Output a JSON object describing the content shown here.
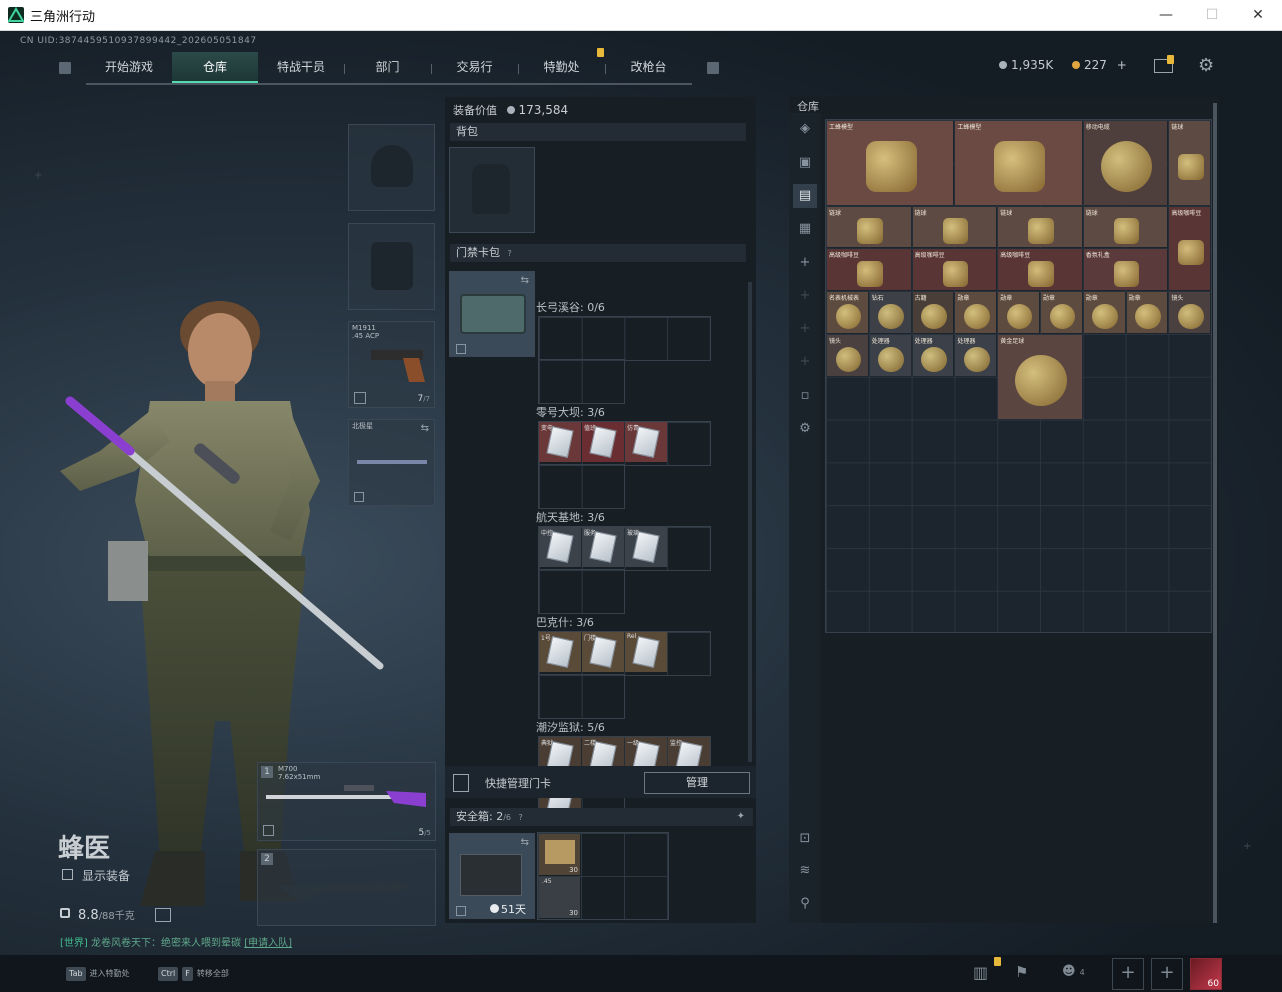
{
  "window": {
    "title": "三角洲行动",
    "min": "—",
    "max": "☐",
    "close": "✕"
  },
  "header": {
    "uid": "CN UID:3874459510937899442_202605051847",
    "tabs": [
      "开始游戏",
      "仓库",
      "特战干员",
      "部门",
      "交易行",
      "特勤处",
      "改枪台"
    ],
    "active_tab": 1,
    "currency1": "1,935K",
    "currency2": "227",
    "currency2_plus": "+",
    "colors": {
      "accent": "#56d9b1",
      "notify": "#e8b83a"
    }
  },
  "operator": {
    "name": "蜂医",
    "show_equipment": "显示装备",
    "weight_value": "8.8",
    "weight_max": "/88千克",
    "chat_channel": "[世界]",
    "chat_text": "龙卷风卷天下：绝密来人喂到晕碳",
    "chat_action": "[申请入队]"
  },
  "loadout": {
    "pistol_name": "M1911",
    "pistol_ammo": ".45 ACP",
    "pistol_count": "7",
    "pistol_max": "/7",
    "melee_name": "北极星",
    "primary_index": "1",
    "primary_name": "M700",
    "primary_ammo": "7.62x51mm",
    "primary_count": "5",
    "primary_max": "/5",
    "secondary_index": "2"
  },
  "gear": {
    "value_label": "装备价值",
    "value": "173,584",
    "backpack_label": "背包",
    "card_bag_label": "门禁卡包",
    "card_sections": [
      {
        "label": "长弓溪谷: 0/6",
        "cards": []
      },
      {
        "label": "零号大坝: 3/6",
        "cards": [
          "变电",
          "值班",
          "仿青"
        ]
      },
      {
        "label": "航天基地: 3/6",
        "cards": [
          "中控",
          "服务",
          "玻璃"
        ]
      },
      {
        "label": "巴克什: 3/6",
        "cards": [
          "1号",
          "门楼",
          "Rel"
        ]
      },
      {
        "label": "潮汐监狱: 5/6",
        "cards": [
          "典狱",
          "二楼",
          "一级",
          "监控",
          "三层"
        ]
      }
    ],
    "quick_manage_label": "快捷管理门卡",
    "manage_button": "管理",
    "safebox_label": "安全箱:",
    "safebox_count": "2",
    "safebox_max": "/6",
    "safebox_timer": "51天",
    "safebox_item1_count": "30",
    "safebox_item2_count": "30",
    "safebox_item2_tag": ".45"
  },
  "stash": {
    "title": "仓库",
    "items": [
      {
        "name": "工蜂模型",
        "col": 0,
        "row": 0,
        "w": 3,
        "h": 2,
        "bg": "#6b4a44"
      },
      {
        "name": "工蜂模型",
        "col": 3,
        "row": 0,
        "w": 3,
        "h": 2,
        "bg": "#6b4a44"
      },
      {
        "name": "移动电缆",
        "col": 6,
        "row": 0,
        "w": 2,
        "h": 2,
        "bg": "#4f3f3c"
      },
      {
        "name": "链球",
        "col": 8,
        "row": 0,
        "w": 1,
        "h": 2,
        "bg": "#5d4a43"
      },
      {
        "name": "链球",
        "col": 0,
        "row": 2,
        "w": 2,
        "h": 1,
        "bg": "#5d4a43"
      },
      {
        "name": "链球",
        "col": 2,
        "row": 2,
        "w": 2,
        "h": 1,
        "bg": "#5d4a43"
      },
      {
        "name": "链球",
        "col": 4,
        "row": 2,
        "w": 2,
        "h": 1,
        "bg": "#5d4a43"
      },
      {
        "name": "链球",
        "col": 6,
        "row": 2,
        "w": 2,
        "h": 1,
        "bg": "#5d4a43"
      },
      {
        "name": "高级咖啡豆",
        "col": 8,
        "row": 2,
        "w": 1,
        "h": 2,
        "bg": "#5a3536"
      },
      {
        "name": "高级咖啡豆",
        "col": 0,
        "row": 3,
        "w": 2,
        "h": 1,
        "bg": "#5a3536"
      },
      {
        "name": "高级咖啡豆",
        "col": 2,
        "row": 3,
        "w": 2,
        "h": 1,
        "bg": "#5a3536"
      },
      {
        "name": "高级咖啡豆",
        "col": 4,
        "row": 3,
        "w": 2,
        "h": 1,
        "bg": "#5a3536"
      },
      {
        "name": "香氛礼盒",
        "col": 6,
        "row": 3,
        "w": 2,
        "h": 1,
        "bg": "#5a3a3a"
      },
      {
        "name": "名表机械表",
        "col": 0,
        "row": 4,
        "w": 1,
        "h": 1,
        "bg": "#5d4b40"
      },
      {
        "name": "钻石",
        "col": 1,
        "row": 4,
        "w": 1,
        "h": 1,
        "bg": "#3e4048"
      },
      {
        "name": "古籍",
        "col": 2,
        "row": 4,
        "w": 1,
        "h": 1,
        "bg": "#4a3e38"
      },
      {
        "name": "勋章",
        "col": 3,
        "row": 4,
        "w": 1,
        "h": 1,
        "bg": "#5d4b40"
      },
      {
        "name": "勋章",
        "col": 4,
        "row": 4,
        "w": 1,
        "h": 1,
        "bg": "#5d4b40"
      },
      {
        "name": "勋章",
        "col": 5,
        "row": 4,
        "w": 1,
        "h": 1,
        "bg": "#5d4b40"
      },
      {
        "name": "勋章",
        "col": 6,
        "row": 4,
        "w": 1,
        "h": 1,
        "bg": "#5d4b40"
      },
      {
        "name": "勋章",
        "col": 7,
        "row": 4,
        "w": 1,
        "h": 1,
        "bg": "#5d4b40"
      },
      {
        "name": "镜头",
        "col": 8,
        "row": 4,
        "w": 1,
        "h": 1,
        "bg": "#4a4040"
      },
      {
        "name": "镜头",
        "col": 0,
        "row": 5,
        "w": 1,
        "h": 1,
        "bg": "#4a4040"
      },
      {
        "name": "处理器",
        "col": 1,
        "row": 5,
        "w": 1,
        "h": 1,
        "bg": "#3c4048"
      },
      {
        "name": "处理器",
        "col": 2,
        "row": 5,
        "w": 1,
        "h": 1,
        "bg": "#3c4048"
      },
      {
        "name": "处理器",
        "col": 3,
        "row": 5,
        "w": 1,
        "h": 1,
        "bg": "#3c4048"
      },
      {
        "name": "黄金足球",
        "col": 4,
        "row": 5,
        "w": 2,
        "h": 2,
        "bg": "#5a4540"
      }
    ]
  },
  "bottom": {
    "key1": "Tab",
    "hint1": "进入特勤处",
    "key2": "Ctrl",
    "key3": "F",
    "hint2": "转移全部",
    "friends_count": "4",
    "level": "60"
  }
}
